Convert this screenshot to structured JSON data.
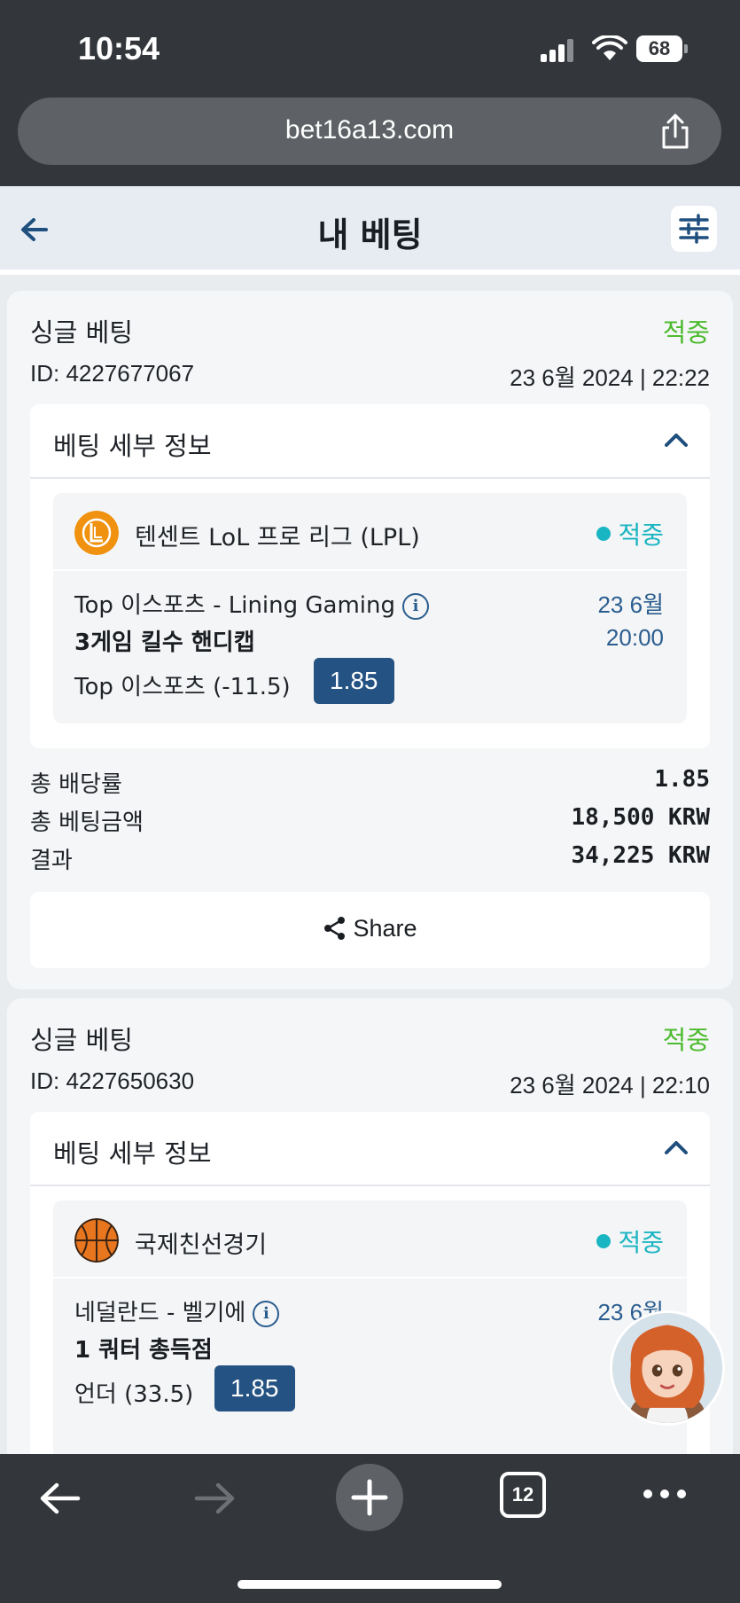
{
  "status_bar": {
    "time": "10:54",
    "battery": "68"
  },
  "browser": {
    "url": "bet16a13.com",
    "tab_count": "12"
  },
  "header": {
    "title": "내 베팅"
  },
  "bets": [
    {
      "type": "싱글 베팅",
      "status": "적중",
      "id": "ID: 4227677067",
      "date": "23 6월 2024 | 22:22",
      "details_title": "베팅 세부 정보",
      "league": "텐센트 LoL 프로 리그 (LPL)",
      "league_icon": "lol-icon",
      "event_status": "적중",
      "match": "Top 이스포츠 - Lining Gaming",
      "match_date": "23 6월",
      "match_time": "20:00",
      "market": "3게임 킬수 핸디캡",
      "selection": "Top 이스포츠 (-11.5)",
      "odds": "1.85",
      "summary": {
        "total_odds_label": "총 배당률",
        "total_odds": "1.85",
        "stake_label": "총 베팅금액",
        "stake": "18,500 KRW",
        "result_label": "결과",
        "result": "34,225 KRW"
      },
      "share_label": "Share"
    },
    {
      "type": "싱글 베팅",
      "status": "적중",
      "id": "ID: 4227650630",
      "date": "23 6월 2024 | 22:10",
      "details_title": "베팅 세부 정보",
      "league": "국제친선경기",
      "league_icon": "basketball-icon",
      "event_status": "적중",
      "match": "네덜란드 - 벨기에",
      "match_date": "23 6월",
      "match_time": "2",
      "market": "1 쿼터 총득점",
      "selection": "언더 (33.5)",
      "odds": "1.85"
    }
  ],
  "colors": {
    "win_green": "#4cbb2f",
    "event_teal": "#1ab5c2",
    "odds_blue": "#245283",
    "chrome_dark": "#33373b"
  }
}
